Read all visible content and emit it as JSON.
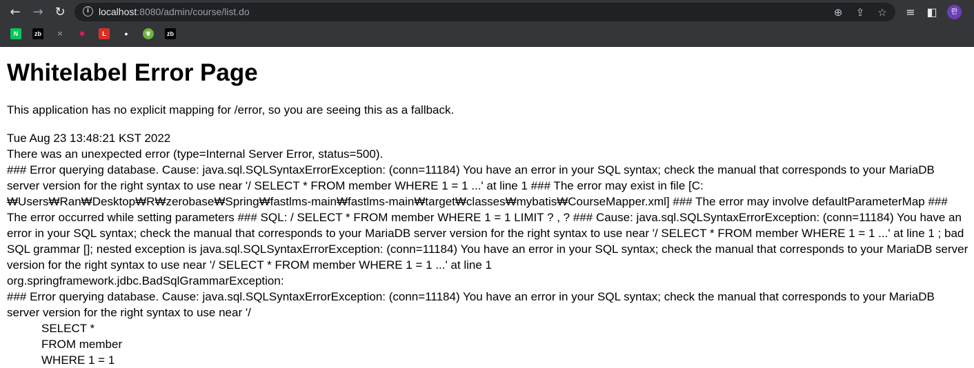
{
  "browser": {
    "url_host": "localhost",
    "url_path": ":8080/admin/course/list.do",
    "avatar_text": "란",
    "bookmarks": [
      {
        "icon": "naver-icon",
        "label": "N",
        "color": "#03c75a",
        "fg": "#ffffff"
      },
      {
        "icon": "zb-icon",
        "label": "zb",
        "color": "#000000",
        "fg": "#ffffff"
      },
      {
        "icon": "dots-icon",
        "label": "⁙",
        "color": "transparent",
        "fg": "#e8eaed"
      },
      {
        "icon": "slack-icon",
        "label": "✱",
        "color": "transparent",
        "fg": "#e01e5a"
      },
      {
        "icon": "l-icon",
        "label": "L",
        "color": "#d93025",
        "fg": "#ffffff"
      },
      {
        "icon": "github-icon",
        "label": "●",
        "color": "transparent",
        "fg": "#ffffff"
      },
      {
        "icon": "spring-icon",
        "label": "❦",
        "color": "#6db33f",
        "fg": "#ffffff"
      },
      {
        "icon": "zb-icon",
        "label": "zb",
        "color": "#000000",
        "fg": "#ffffff"
      }
    ]
  },
  "page": {
    "title": "Whitelabel Error Page",
    "fallback": "This application has no explicit mapping for /error, so you are seeing this as a fallback.",
    "timestamp": "Tue Aug 23 13:48:21 KST 2022",
    "status_line": "There was an unexpected error (type=Internal Server Error, status=500).",
    "error_para1": "### Error querying database. Cause: java.sql.SQLSyntaxErrorException: (conn=11184) You have an error in your SQL syntax; check the manual that corresponds to your MariaDB server version for the right syntax to use near '/ SELECT * FROM member WHERE 1 = 1 ...' at line 1 ### The error may exist in file [C:₩Users₩Ran₩Desktop₩R₩zerobase₩Spring₩fastlms-main₩fastlms-main₩target₩classes₩mybatis₩CourseMapper.xml] ### The error may involve defaultParameterMap ### The error occurred while setting parameters ### SQL: / SELECT * FROM member WHERE 1 = 1 LIMIT ? , ? ### Cause: java.sql.SQLSyntaxErrorException: (conn=11184) You have an error in your SQL syntax; check the manual that corresponds to your MariaDB server version for the right syntax to use near '/ SELECT * FROM member WHERE 1 = 1 ...' at line 1 ; bad SQL grammar []; nested exception is java.sql.SQLSyntaxErrorException: (conn=11184) You have an error in your SQL syntax; check the manual that corresponds to your MariaDB server version for the right syntax to use near '/ SELECT * FROM member WHERE 1 = 1 ...' at line 1",
    "exception_class": "org.springframework.jdbc.BadSqlGrammarException:",
    "error_para2": "### Error querying database.  Cause: java.sql.SQLSyntaxErrorException: (conn=11184) You have an error in your SQL syntax; check the manual that corresponds to your MariaDB server version for the right syntax to use near '/",
    "sql_lines": [
      "SELECT *",
      "FROM member",
      "WHERE 1 = 1"
    ]
  }
}
